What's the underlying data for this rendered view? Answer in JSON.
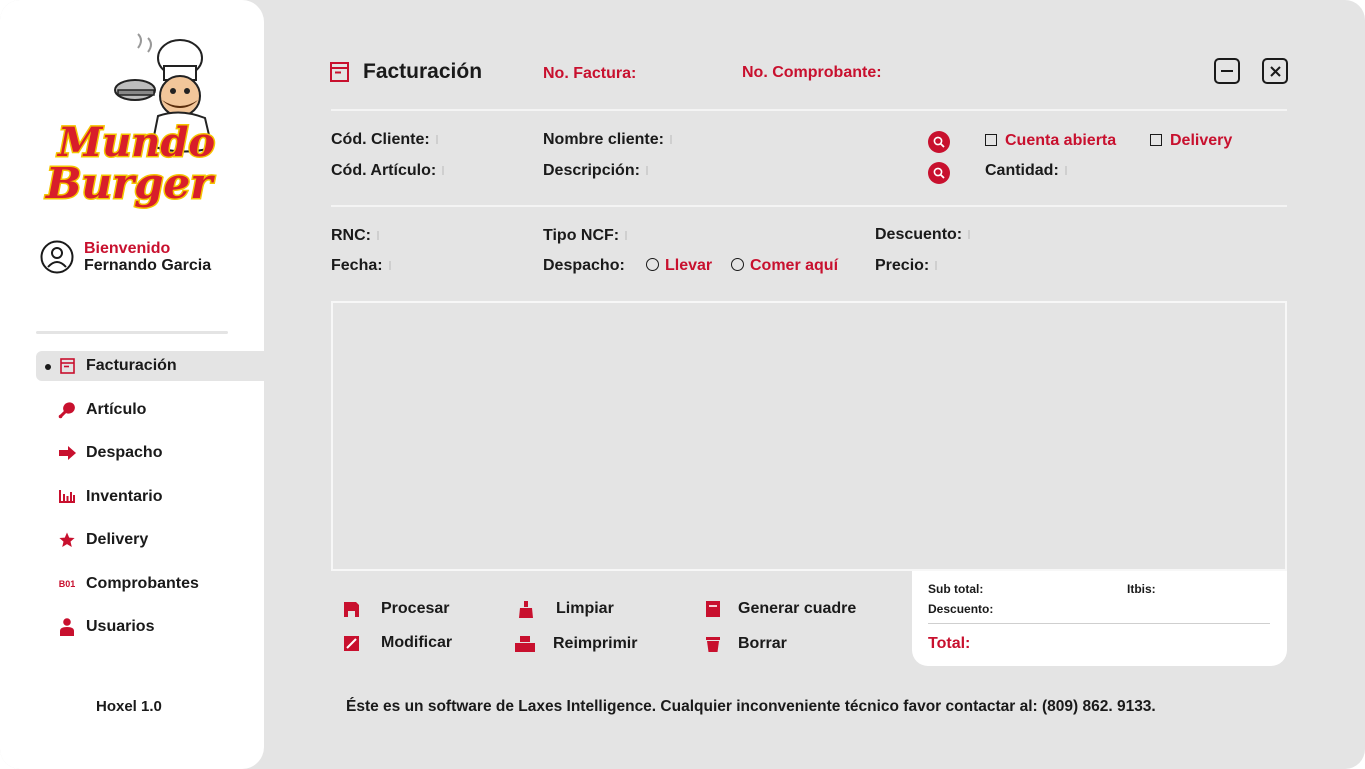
{
  "brand": {
    "logo_line1": "Mundo",
    "logo_line2": "Burger"
  },
  "user": {
    "greeting": "Bienvenido",
    "name": "Fernando Garcia"
  },
  "nav": {
    "items": [
      {
        "label": "Facturación",
        "icon": "invoice-icon",
        "active": true
      },
      {
        "label": "Artículo",
        "icon": "drumstick-icon"
      },
      {
        "label": "Despacho",
        "icon": "arrow-right-icon"
      },
      {
        "label": "Inventario",
        "icon": "bar-chart-icon"
      },
      {
        "label": "Delivery",
        "icon": "star-icon"
      },
      {
        "label": "Comprobantes",
        "icon": "b01-icon",
        "icon_text": "B01"
      },
      {
        "label": "Usuarios",
        "icon": "user-icon"
      }
    ]
  },
  "version": "Hoxel 1.0",
  "header": {
    "title": "Facturación",
    "invoice_no_label": "No. Factura:",
    "voucher_no_label": "No. Comprobante:"
  },
  "form": {
    "client_code": "Cód. Cliente:",
    "client_name": "Nombre cliente:",
    "open_account": "Cuenta abierta",
    "delivery": "Delivery",
    "article_code": "Cód. Artículo:",
    "description": "Descripción:",
    "quantity": "Cantidad:",
    "rnc": "RNC:",
    "ncf_type": "Tipo NCF:",
    "discount": "Descuento:",
    "date": "Fecha:",
    "dispatch": "Despacho:",
    "take_away": "Llevar",
    "eat_here": "Comer aquí",
    "price": "Precio:"
  },
  "actions": {
    "process": "Procesar",
    "clear": "Limpiar",
    "generate_report": "Generar cuadre",
    "modify": "Modificar",
    "reprint": "Reimprimir",
    "delete": "Borrar"
  },
  "totals": {
    "subtotal": "Sub total:",
    "itbis": "Itbis:",
    "discount": "Descuento:",
    "total": "Total:"
  },
  "footer": {
    "text": "Éste es un software de Laxes Intelligence. Cualquier inconveniente técnico favor contactar al:  (809) 862. 9133."
  },
  "colors": {
    "accent": "#c8102e",
    "background": "#e4e4e4",
    "panel": "#ffffff"
  }
}
